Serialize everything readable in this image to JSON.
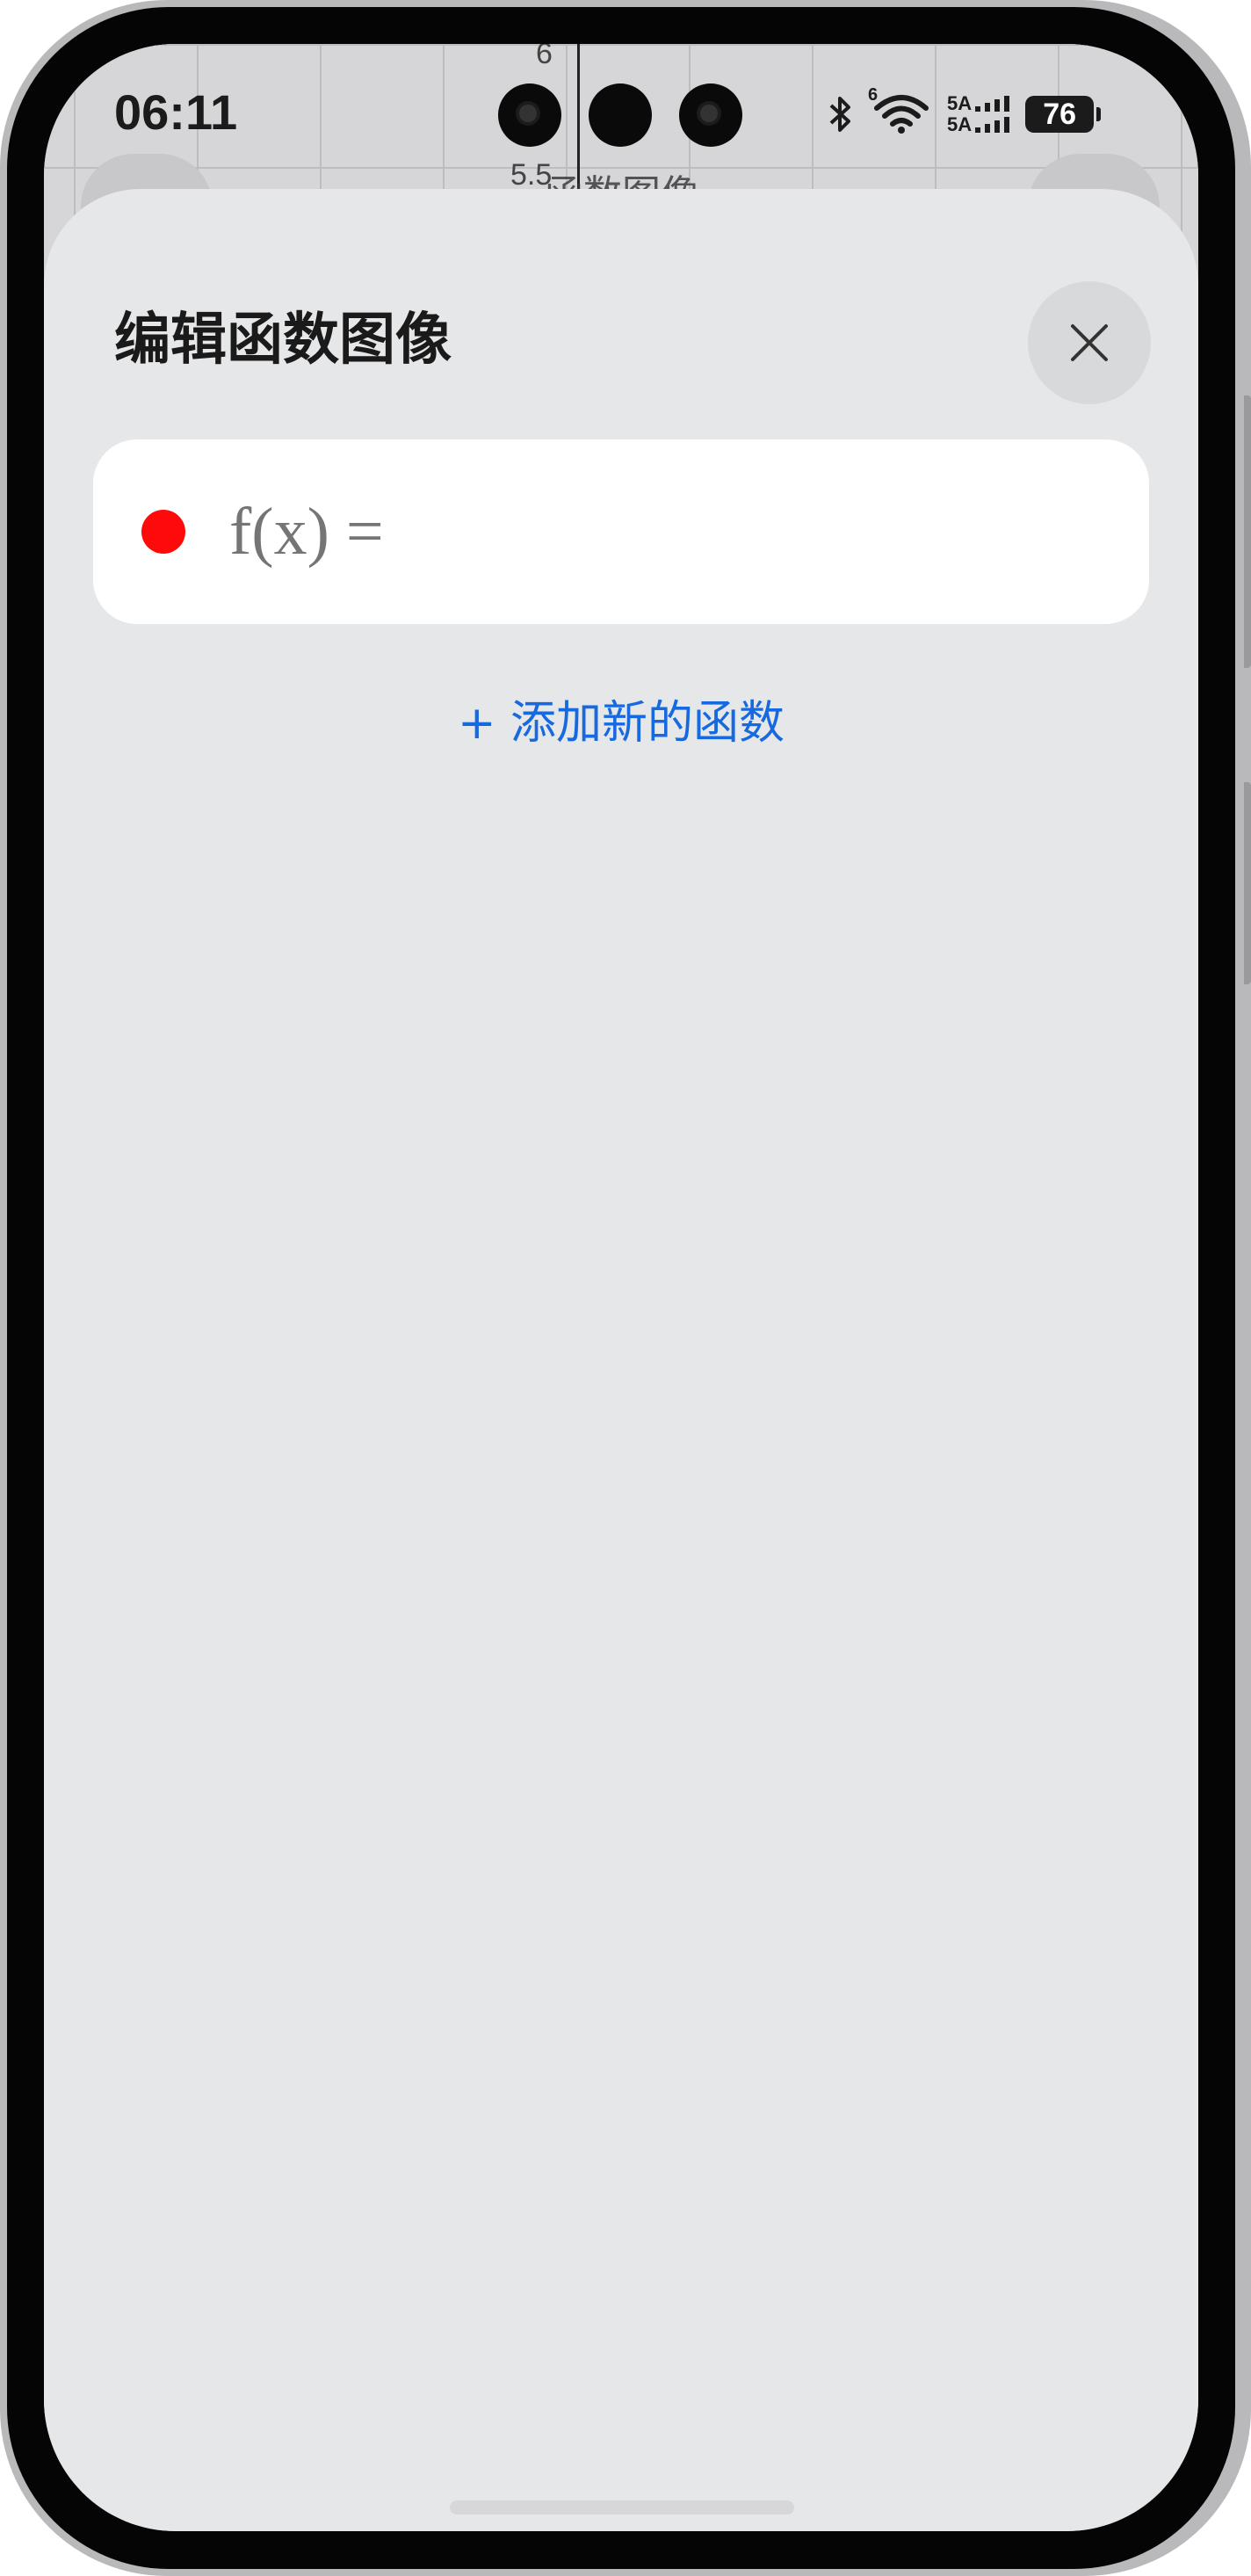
{
  "status_bar": {
    "time": "06:11",
    "network_top": "5A",
    "network_bottom": "5A",
    "wifi_badge": "6",
    "battery": "76"
  },
  "background_graph": {
    "tick_top": "6",
    "tick_bottom": "5.5",
    "title": "函数图像"
  },
  "sheet": {
    "title": "编辑函数图像",
    "close_icon": "close-icon",
    "functions": [
      {
        "color": "#ff0a0a",
        "label": "f(x) =",
        "value": ""
      }
    ],
    "add_function_label": "+ 添加新的函数"
  },
  "colors": {
    "accent": "#1769e0",
    "sheet_bg": "#e6e7e9",
    "card_bg": "#ffffff",
    "function_dot": "#ff0a0a"
  }
}
